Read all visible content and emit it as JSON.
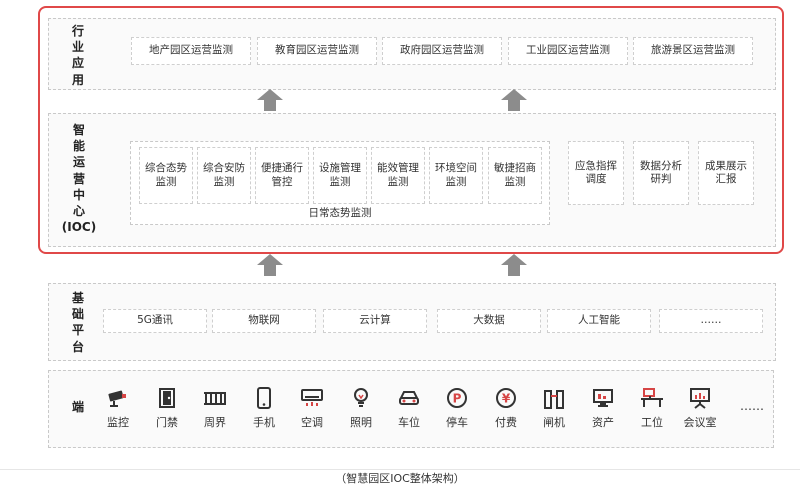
{
  "colors": {
    "frame_red": "#e04848",
    "arrow_gray": "#8c8c8c",
    "icon_dark": "#333333",
    "icon_red": "#d64545"
  },
  "industry": {
    "label": "行\n业\n应\n用",
    "items": [
      "地产园区运营监测",
      "教育园区运营监测",
      "政府园区运营监测",
      "工业园区运营监测",
      "旅游景区运营监测"
    ]
  },
  "ioc": {
    "label": "智\n能\n运\n营\n中\n心\n(IOC)",
    "daily": {
      "items": [
        "综合态势\n监测",
        "综合安防\n监测",
        "便捷通行\n管控",
        "设施管理\n监测",
        "能效管理\n监测",
        "环境空间\n监测",
        "敏捷招商\n监测"
      ],
      "caption": "日常态势监测"
    },
    "others": [
      "应急指挥\n调度",
      "数据分析\n研判",
      "成果展示\n汇报"
    ]
  },
  "base": {
    "label": "基\n础\n平\n台",
    "items": [
      "5G通讯",
      "物联网",
      "云计算",
      "大数据",
      "人工智能",
      "……"
    ]
  },
  "terminal": {
    "label": "端",
    "items": [
      {
        "label": "监控",
        "icon": "camera-icon"
      },
      {
        "label": "门禁",
        "icon": "door-icon"
      },
      {
        "label": "周界",
        "icon": "fence-icon"
      },
      {
        "label": "手机",
        "icon": "phone-icon"
      },
      {
        "label": "空调",
        "icon": "air-conditioner-icon"
      },
      {
        "label": "照明",
        "icon": "bulb-icon"
      },
      {
        "label": "车位",
        "icon": "car-icon"
      },
      {
        "label": "停车",
        "icon": "parking-icon"
      },
      {
        "label": "付费",
        "icon": "yen-icon"
      },
      {
        "label": "闸机",
        "icon": "gate-icon"
      },
      {
        "label": "资产",
        "icon": "monitor-icon"
      },
      {
        "label": "工位",
        "icon": "workstation-icon"
      },
      {
        "label": "会议室",
        "icon": "presentation-icon"
      }
    ],
    "more": "……"
  },
  "caption": "（智慧园区IOC整体架构）"
}
